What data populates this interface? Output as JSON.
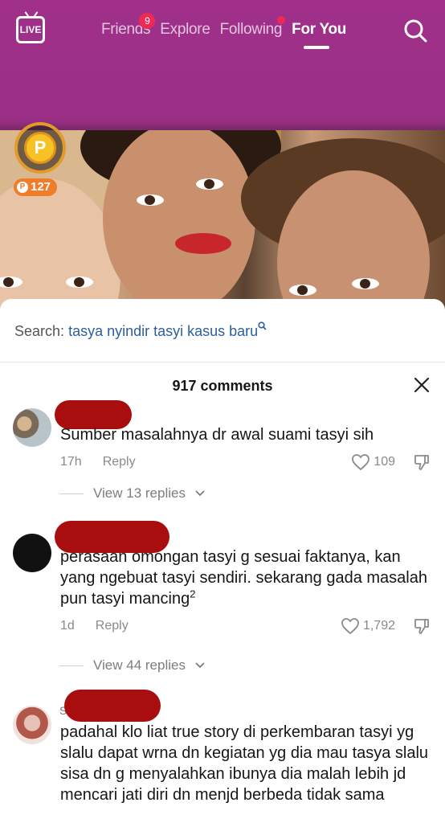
{
  "nav": {
    "live_label": "LIVE",
    "tabs": [
      {
        "label": "Friends",
        "badge": "9"
      },
      {
        "label": "Explore"
      },
      {
        "label": "Following",
        "dot": true
      },
      {
        "label": "For You",
        "active": true
      }
    ],
    "search_icon": "search-icon"
  },
  "reward": {
    "points": "127",
    "coin_letter": "P"
  },
  "search": {
    "prefix": "Search:",
    "query": "tasya nyindir tasyi kasus baru"
  },
  "comments_header": {
    "count_label": "917 comments"
  },
  "comments": [
    {
      "text": "Sumber masalahnya dr awal suami tasyi sih",
      "time": "17h",
      "reply": "Reply",
      "likes": "109",
      "view_replies": "View 13 replies"
    },
    {
      "text": "perasaan omongan tasyi g sesuai faktanya, kan yang ngebuat tasyi sendiri. sekarang gada masalah pun tasyi mancing",
      "text_sup": "2",
      "time": "1d",
      "reply": "Reply",
      "likes": "1,792",
      "view_replies": "View 44 replies"
    },
    {
      "username_fragment": "S",
      "text": "padahal klo liat true story di perkembaran tasyi yg slalu dapat wrna dn kegiatan yg dia mau tasya slalu sisa dn g menyalahkan ibunya dia malah lebih jd mencari jati diri dn menjd berbeda tidak sama"
    }
  ],
  "colors": {
    "header": "#9a2f86",
    "badge": "#ee2a54",
    "redaction": "#a90e0e",
    "link": "#2a5f9e",
    "points": "#f07d2a"
  }
}
